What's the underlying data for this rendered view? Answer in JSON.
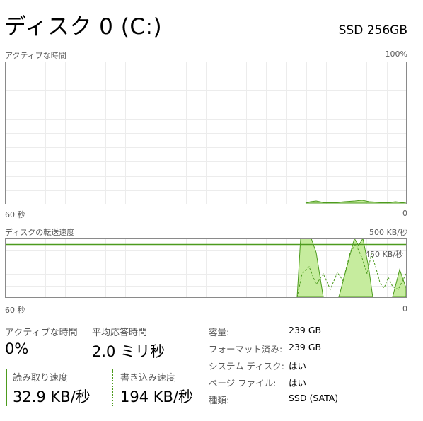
{
  "header": {
    "title": "ディスク 0 (C:)",
    "model": "SSD 256GB"
  },
  "active_time_graph": {
    "label": "アクティブな時間",
    "max_label": "100%",
    "time_label": "60 秒",
    "min_label": "0"
  },
  "transfer_graph": {
    "label": "ディスクの転送速度",
    "max_label": "500 KB/秒",
    "marker_label": "450 KB/秒",
    "time_label": "60 秒",
    "min_label": "0"
  },
  "stats": {
    "active_time": {
      "label": "アクティブな時間",
      "value": "0%"
    },
    "avg_response": {
      "label": "平均応答時間",
      "value": "2.0 ミリ秒"
    },
    "read_speed": {
      "label": "読み取り速度",
      "value": "32.9 KB/秒"
    },
    "write_speed": {
      "label": "書き込み速度",
      "value": "194 KB/秒"
    }
  },
  "properties": [
    {
      "key": "容量:",
      "value": "239 GB"
    },
    {
      "key": "フォーマット済み:",
      "value": "239 GB"
    },
    {
      "key": "システム ディスク:",
      "value": "はい"
    },
    {
      "key": "ページ ファイル:",
      "value": "はい"
    },
    {
      "key": "種類:",
      "value": "SSD (SATA)"
    }
  ],
  "colors": {
    "accent": "#4d9b1e",
    "fill": "#c6ec9e",
    "border": "#8a8a8a",
    "grid": "#ececec"
  }
}
